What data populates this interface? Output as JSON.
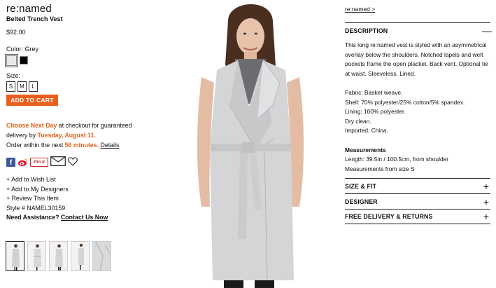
{
  "product": {
    "brand": "re:named",
    "name": "Belted Trench Vest",
    "price": "$92.00"
  },
  "color": {
    "label": "Color: Grey",
    "swatches": [
      "Grey",
      "Black"
    ]
  },
  "size": {
    "label": "Size:",
    "options": [
      "S",
      "M",
      "L"
    ]
  },
  "cart_button": "ADD TO CART",
  "delivery": {
    "promo": "Choose Next Day",
    "text1": " at checkout for guaranteed delivery by ",
    "date": "Tuesday, August 11.",
    "text2": "Order within the next ",
    "countdown": "56 minutes.",
    "details": "Details"
  },
  "social": {
    "facebook": "f",
    "pinterest": "Pin it"
  },
  "links": {
    "wishlist": "+ Add to Wish List",
    "designers": "+ Add to My Designers",
    "review": "+ Review This Item",
    "style": "Style # NAMEL30159",
    "assist_label": "Need Assistance?",
    "contact": "Contact Us Now"
  },
  "right": {
    "brand_link": "re:named >",
    "description_title": "DESCRIPTION",
    "description": "This long re:named vest is styled with an asymmetrical overlay below the shoulders. Notched lapels and welt pockets frame the open placket. Back vent. Optional tie at waist. Sleeveless. Lined.",
    "fabric": "Fabric: Basket weave.",
    "shell": "Shell: 70% polyester/25% cotton/5% spandex.",
    "lining": "Lining: 100% polyester.",
    "care": "Dry clean.",
    "origin": "Imported, China.",
    "measurements_title": "Measurements",
    "length": "Length: 39.5in / 100.5cm, from shoulder",
    "size_note": "Measurements from size S",
    "sections": [
      "SIZE & FIT",
      "DESIGNER",
      "FREE DELIVERY & RETURNS"
    ]
  },
  "colors": {
    "accent": "#e8601c",
    "garment": "#d3d5d7",
    "facebook": "#3b5998",
    "pinterest": "#c8232c"
  }
}
